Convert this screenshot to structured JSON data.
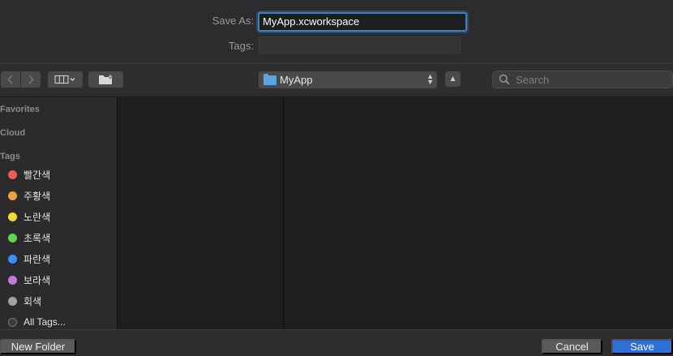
{
  "form": {
    "save_as_label": "Save As:",
    "save_as_value": "MyApp.xcworkspace",
    "tags_label": "Tags:"
  },
  "toolbar": {
    "location": "MyApp",
    "search_placeholder": "Search"
  },
  "sidebar": {
    "favorites_header": "Favorites",
    "icloud_header": "Cloud",
    "tags_header": "Tags",
    "tags": [
      {
        "label": "빨간색",
        "color": "#ee5c55"
      },
      {
        "label": "주황색",
        "color": "#f2a23c"
      },
      {
        "label": "노란색",
        "color": "#f5d832"
      },
      {
        "label": "초록색",
        "color": "#5bd84c"
      },
      {
        "label": "파란색",
        "color": "#3b8ff0"
      },
      {
        "label": "보라색",
        "color": "#c377e0"
      },
      {
        "label": "회색",
        "color": "#a3a3a6"
      },
      {
        "label": "All Tags...",
        "color": "hollow"
      }
    ]
  },
  "buttons": {
    "new_folder": "New Folder",
    "cancel": "Cancel",
    "save": "Save"
  },
  "icons": {
    "back": "chevron-left-icon",
    "forward": "chevron-right-icon",
    "view": "column-view-icon",
    "new_folder": "new-folder-icon",
    "folder": "folder-icon",
    "updown": "up-down-arrows-icon",
    "collapse": "chevron-up-icon",
    "search": "search-icon"
  },
  "accent_color": "#2f6fd6"
}
